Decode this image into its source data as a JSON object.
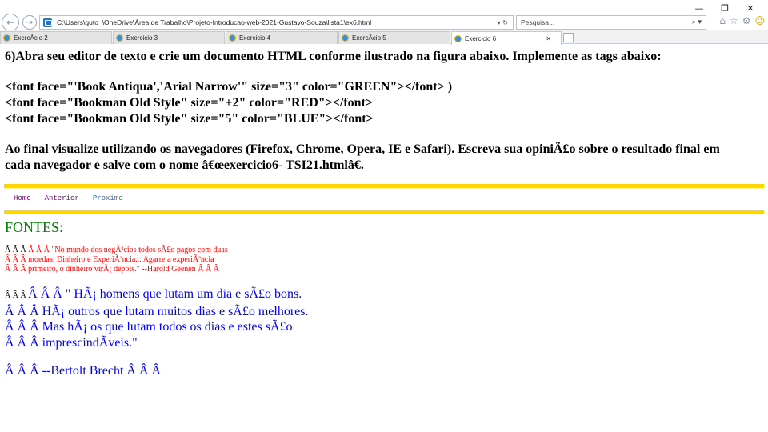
{
  "window": {
    "minimize_glyph": "—",
    "restore_glyph": "❐",
    "close_glyph": "✕"
  },
  "nav": {
    "back_icon": "arrow-left-icon",
    "forward_icon": "arrow-right-icon",
    "url": "C:\\Users\\guto_\\OneDrive\\Área de Trabalho\\Projeto-Introducao-web-2021-Gustavo-Souza\\lista1\\ex6.html",
    "url_tools": "▾ ↻",
    "search_placeholder": "Pesquisa...",
    "search_tools": "⌕ ▾",
    "home_glyph": "⌂",
    "favorites_glyph": "☆",
    "settings_glyph": "⚙",
    "feedback_glyph": "☺"
  },
  "tabs": [
    {
      "label": "ExercÃ­cio 2"
    },
    {
      "label": "Exercicio 3"
    },
    {
      "label": "Exercicio 4"
    },
    {
      "label": "ExercÃ­cio 5"
    },
    {
      "label": "Exercicio 6",
      "active": true
    }
  ],
  "tab_close_glyph": "✕",
  "page": {
    "instruction_lines": [
      "6)Abra seu editor de texto e crie um documento HTML conforme ilustrado na figura abaixo. Implemente as tags abaixo:",
      "<font face=\"'Book Antiqua','Arial Narrow'\" size=\"3\" color=\"GREEN\"></font> )",
      "<font face=\"Bookman Old Style\" size=\"+2\" color=\"RED\"></font>",
      "<font face=\"Bookman Old Style\" size=\"5\" color=\"BLUE\"></font>",
      "Ao final visualize utilizando os navegadores (Firefox, Chrome, Opera, IE e Safari). Escreva sua opiniÃ£o sobre o resultado final em",
      "cada navegador e salve com o nome â€œexercicio6- TSI21.htmlâ€."
    ],
    "menu": [
      "Home",
      "Anterior",
      "Proximo"
    ],
    "fontes_title": "FONTES:",
    "quote1": {
      "prefix": "Â Â Â ",
      "lines": [
        "Â Â Â \"No mundo dos negÃ³cios todos sÃ£o pagos com duas",
        "Â Â Â moedas: Dinheiro e ExperiÃªncia... Agarre a experiÃªncia",
        "Â Â Â primeiro, o dinheiro virÃ¡ depois.\" --Harold Geenen Â Â Â"
      ]
    },
    "quote2": {
      "prefix": "Â Â Â ",
      "lines": [
        "Â Â Â \" HÃ¡ homens que lutam um dia e sÃ£o bons.",
        "Â Â Â HÃ¡ outros que lutam muitos dias e sÃ£o melhores.",
        "Â Â Â Mas hÃ¡ os que lutam todos os dias e estes sÃ£o",
        "Â Â Â imprescindÃ­veis.\""
      ],
      "author": "Â Â Â --Bertolt Brecht Â Â Â"
    }
  }
}
